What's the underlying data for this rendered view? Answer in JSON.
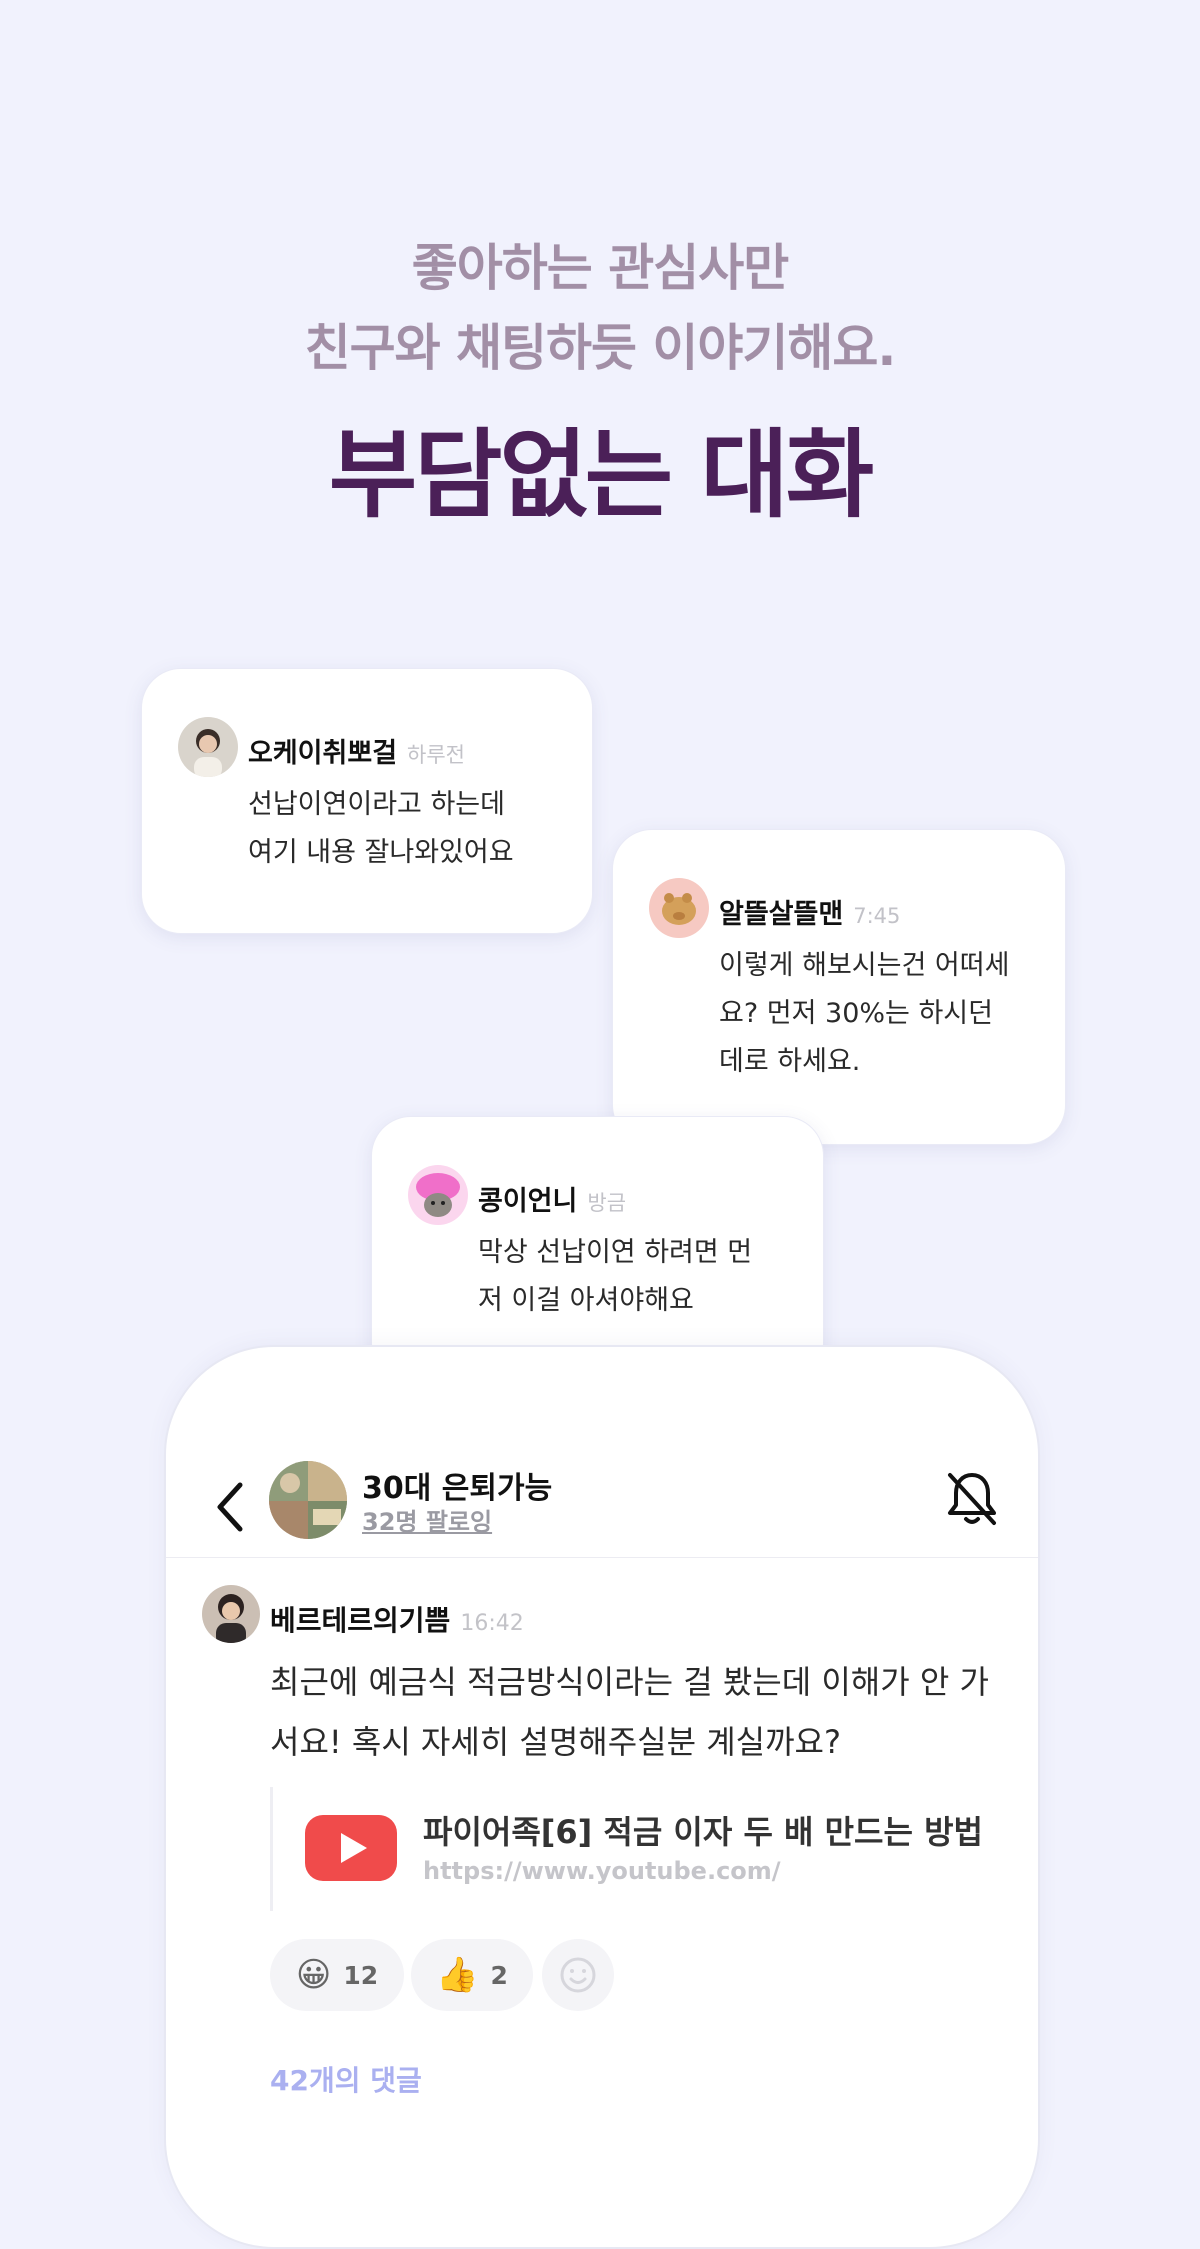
{
  "hero": {
    "subtitle_line1": "좋아하는 관심사만",
    "subtitle_line2": "친구와 채팅하듯 이야기해요.",
    "title": "부담없는 대화"
  },
  "bubbles": [
    {
      "name": "오케이취뽀걸",
      "time": "하루전",
      "message": "선납이연이라고 하는데\n여기 내용 잘나와있어요",
      "avatar_icon": "person-avatar"
    },
    {
      "name": "알뜰살뜰맨",
      "time": "7:45",
      "message": "이렇게 해보시는건 어떠세\n요? 먼저 30%는 하시던\n데로 하세요.",
      "avatar_icon": "piggy-bank-avatar"
    },
    {
      "name": "콩이언니",
      "time": "방금",
      "message": "막상 선납이연 하려면 먼\n저 이걸 아셔야해요",
      "avatar_icon": "cat-avatar"
    }
  ],
  "chat": {
    "group_title": "30대 은퇴가능",
    "group_followers": "32명 팔로잉",
    "post": {
      "author": "베르테르의기쁨",
      "time": "16:42",
      "body": "최근에 예금식 적금방식이라는 걸 봤는데 이해가 안 가서요! 혹시 자세히 설명해주실분 계실까요?",
      "link_title": "파이어족[6] 적금 이자 두 배 만드는 방법",
      "link_url": "https://www.youtube.com/"
    },
    "reactions": [
      {
        "emoji": "😀",
        "count": "12"
      },
      {
        "emoji": "👍",
        "count": "2"
      }
    ],
    "comments_label": "42개의 댓글"
  },
  "colors": {
    "background": "#f1f2fd",
    "title": "#4b2058",
    "subtitle": "#a28fa6",
    "youtube_red": "#f04b4b",
    "comments_accent": "#aab0f0"
  }
}
